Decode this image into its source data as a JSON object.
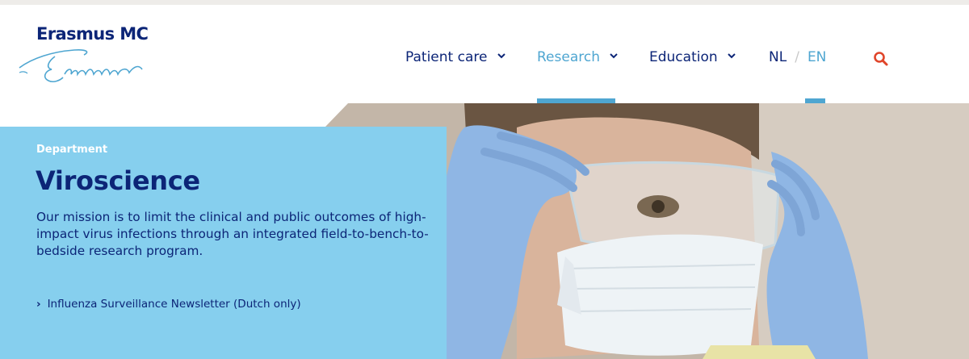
{
  "header": {
    "logo_text": "Erasmus MC"
  },
  "nav": {
    "items": [
      {
        "label": "Patient care",
        "active": false
      },
      {
        "label": "Research",
        "active": true
      },
      {
        "label": "Education",
        "active": false
      }
    ],
    "lang": {
      "nl": "NL",
      "separator": "/",
      "en": "EN",
      "active": "EN"
    },
    "search_icon": "search-icon"
  },
  "hero": {
    "eyebrow": "Department",
    "title": "Viroscience",
    "mission": "Our mission is to limit the clinical and public outcomes of high-impact virus infections through an integrated field-to-bench-to-bedside research program.",
    "link_label": "Influenza Surveillance Newsletter (Dutch only)",
    "link_icon": "chevron-right-icon"
  },
  "colors": {
    "brand_navy": "#0c2577",
    "accent_blue": "#4fa6d1",
    "panel_blue": "#86cfee",
    "search_orange": "#e0452a"
  }
}
